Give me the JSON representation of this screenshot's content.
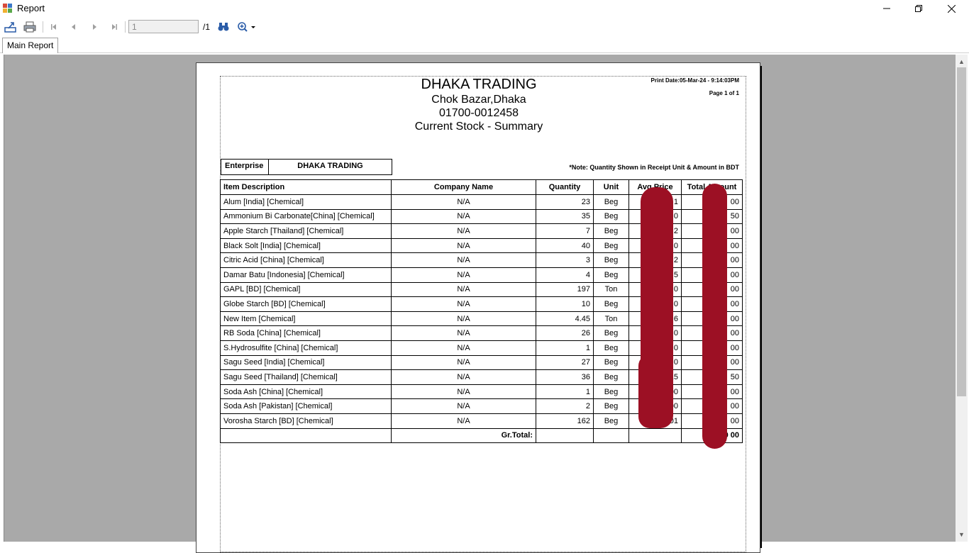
{
  "window": {
    "title": "Report",
    "minimize": "—",
    "maximize": "❐",
    "close": "✕"
  },
  "toolbar": {
    "page_value": "1",
    "page_total": "/1"
  },
  "tabs": [
    {
      "label": "Main Report"
    }
  ],
  "report": {
    "company": "DHAKA TRADING",
    "address": "Chok Bazar,Dhaka",
    "phone": "01700-0012458",
    "title": "Current Stock - Summary",
    "print_date": "Print Date:05-Mar-24 - 9:14:03PM",
    "page_info": "Page 1 of 1",
    "enterprise_label": "Enterprise",
    "enterprise_value": "DHAKA TRADING",
    "note": "*Note: Quantity Shown in Receipt Unit &  Amount in BDT",
    "columns": [
      "Item Description",
      "Company Name",
      "Quantity",
      "Unit",
      "Avg.Price",
      "Total Amount"
    ],
    "rows": [
      {
        "item": "Alum [India] [Chemical]",
        "company": "N/A",
        "qty": "23",
        "unit": "Beg",
        "avg": "1",
        "total": "00"
      },
      {
        "item": "Ammonium Bi Carbonate[China] [Chemical]",
        "company": "N/A",
        "qty": "35",
        "unit": "Beg",
        "avg": "0",
        "total": "50"
      },
      {
        "item": "Apple Starch [Thailand] [Chemical]",
        "company": "N/A",
        "qty": "7",
        "unit": "Beg",
        "avg": "2",
        "total": "00"
      },
      {
        "item": "Black Solt [India] [Chemical]",
        "company": "N/A",
        "qty": "40",
        "unit": "Beg",
        "avg": "0",
        "total": "00"
      },
      {
        "item": "Citric Acid [China] [Chemical]",
        "company": "N/A",
        "qty": "3",
        "unit": "Beg",
        "avg": "2",
        "total": "00"
      },
      {
        "item": "Damar Batu [Indonesia] [Chemical]",
        "company": "N/A",
        "qty": "4",
        "unit": "Beg",
        "avg": "5",
        "total": "00"
      },
      {
        "item": "GAPL [BD] [Chemical]",
        "company": "N/A",
        "qty": "197",
        "unit": "Ton",
        "avg": "0",
        "total": "00"
      },
      {
        "item": "Globe Starch [BD] [Chemical]",
        "company": "N/A",
        "qty": "10",
        "unit": "Beg",
        "avg": "0",
        "total": "00"
      },
      {
        "item": "New Item [Chemical]",
        "company": "N/A",
        "qty": "4.45",
        "unit": "Ton",
        "avg": "6",
        "total": "00"
      },
      {
        "item": "RB Soda [China] [Chemical]",
        "company": "N/A",
        "qty": "26",
        "unit": "Beg",
        "avg": "0",
        "total": "00"
      },
      {
        "item": "S.Hydrosulfite [China] [Chemical]",
        "company": "N/A",
        "qty": "1",
        "unit": "Beg",
        "avg": "0",
        "total": "00"
      },
      {
        "item": "Sagu Seed [India] [Chemical]",
        "company": "N/A",
        "qty": "27",
        "unit": "Beg",
        "avg": "0",
        "total": "00"
      },
      {
        "item": "Sagu Seed [Thailand] [Chemical]",
        "company": "N/A",
        "qty": "36",
        "unit": "Beg",
        "avg": "15",
        "total": "50"
      },
      {
        "item": "Soda Ash [China] [Chemical]",
        "company": "N/A",
        "qty": "1",
        "unit": "Beg",
        "avg": ".00",
        "total": "00"
      },
      {
        "item": "Soda Ash [Pakistan] [Chemical]",
        "company": "N/A",
        "qty": "2",
        "unit": "Beg",
        "avg": ".00",
        "total": "00"
      },
      {
        "item": "Vorosha Starch [BD] [Chemical]",
        "company": "N/A",
        "qty": "162",
        "unit": "Beg",
        "avg": ".01",
        "total": "00"
      }
    ],
    "grand_total_label": "Gr.Total:",
    "grand_total_value": "1,0      00"
  },
  "colors": {
    "viewer_bg": "#a9a9a9",
    "redaction": "#9c1024"
  }
}
